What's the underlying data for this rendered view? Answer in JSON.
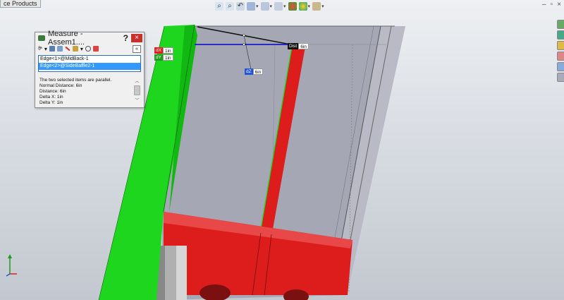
{
  "tab": {
    "label": "ce Products"
  },
  "heads_up_toolbar": {
    "icons": [
      "zoom-to-fit-icon",
      "zoom-area-icon",
      "previous-view-icon",
      "section-view-icon",
      "view-orientation-icon",
      "display-style-icon",
      "hide-show-icon",
      "edit-appearance-icon",
      "apply-scene-icon",
      "view-settings-icon"
    ]
  },
  "measure": {
    "title": "Measure - Assem1....",
    "help": "?",
    "close": "×",
    "units_label": "ꔭ",
    "collapse": "«",
    "selections": [
      "Edge<1>@MidBack-1",
      "Edge<2>@SideBaffle2-1"
    ],
    "results": [
      "The two selected items are parallel.",
      "Normal Distance: 6in",
      "Distance: 6in",
      "Delta X: 1in",
      "Delta Y: 1in"
    ]
  },
  "dimensions": {
    "dx": {
      "key": "dX",
      "value": "1in",
      "color": "#e02020"
    },
    "dy": {
      "key": "dY",
      "value": "1in",
      "color": "#1f9a1f"
    },
    "dist": {
      "key": "Dist",
      "value": "6in",
      "color": "#111111"
    },
    "dz": {
      "key": "dZ",
      "value": "6in",
      "color": "#2255dd"
    }
  },
  "colors": {
    "green_part": "#1fd61f",
    "red_part": "#dd1c1c",
    "grey_part": "#a6a7b5",
    "measure_line": "#1a1acc"
  }
}
